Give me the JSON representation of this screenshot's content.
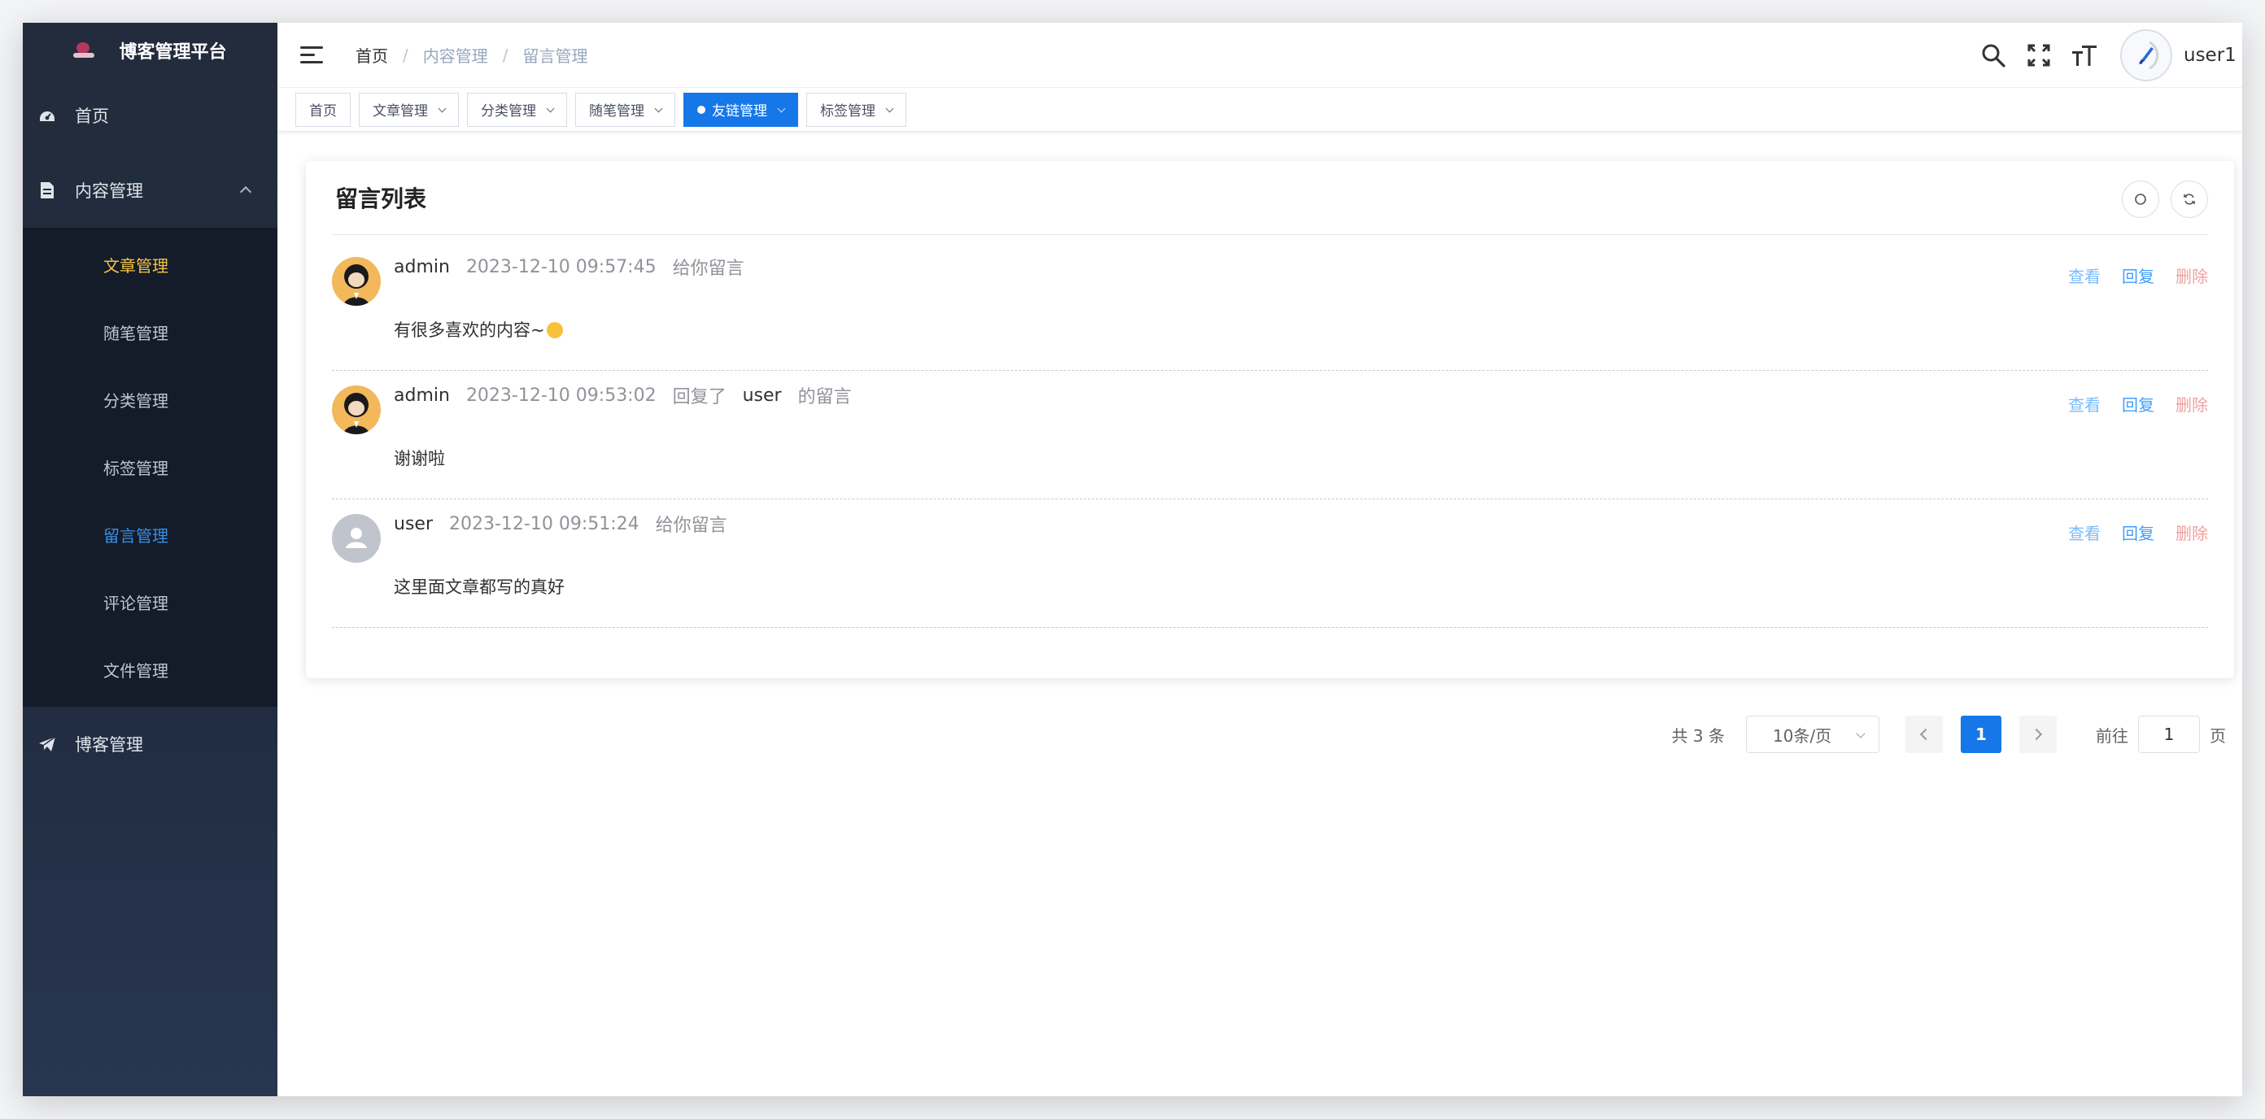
{
  "app": {
    "title": "博客管理平台"
  },
  "colors": {
    "sidebar_bg": "#222c3c",
    "accent": "#1677e8",
    "active_yellow": "#f6c342"
  },
  "sidebar": {
    "items": [
      {
        "label": "首页",
        "icon": "dashboard-icon"
      },
      {
        "label": "内容管理",
        "icon": "document-icon",
        "expanded": true
      },
      {
        "label": "博客管理",
        "icon": "paper-plane-icon"
      }
    ],
    "subitems": [
      {
        "label": "文章管理"
      },
      {
        "label": "随笔管理"
      },
      {
        "label": "分类管理"
      },
      {
        "label": "标签管理"
      },
      {
        "label": "留言管理"
      },
      {
        "label": "评论管理"
      },
      {
        "label": "文件管理"
      }
    ]
  },
  "header": {
    "breadcrumb": [
      "首页",
      "内容管理",
      "留言管理"
    ],
    "breadcrumb_sep": "/",
    "username": "user1"
  },
  "tags": [
    {
      "label": "首页"
    },
    {
      "label": "文章管理"
    },
    {
      "label": "分类管理"
    },
    {
      "label": "随笔管理"
    },
    {
      "label": "友链管理",
      "active": true
    },
    {
      "label": "标签管理"
    }
  ],
  "card": {
    "title": "留言列表",
    "messages": [
      {
        "name": "admin",
        "time": "2023-12-10 09:57:45",
        "action": "给你留言",
        "target": "",
        "target_suffix": "",
        "content": "有很多喜欢的内容~",
        "avatar": "admin-avatar"
      },
      {
        "name": "admin",
        "time": "2023-12-10 09:53:02",
        "action": "回复了",
        "target": "user",
        "target_suffix": "的留言",
        "content": "谢谢啦",
        "avatar": "admin-avatar"
      },
      {
        "name": "user",
        "time": "2023-12-10 09:51:24",
        "action": "给你留言",
        "target": "",
        "target_suffix": "",
        "content": "这里面文章都写的真好",
        "avatar": "user-default-avatar"
      }
    ],
    "ops": {
      "view": "查看",
      "reply": "回复",
      "delete": "删除"
    }
  },
  "pagination": {
    "total": "共 3 条",
    "page_size": "10条/页",
    "current": "1",
    "goto_prefix": "前往",
    "goto_value": "1",
    "goto_suffix": "页"
  }
}
